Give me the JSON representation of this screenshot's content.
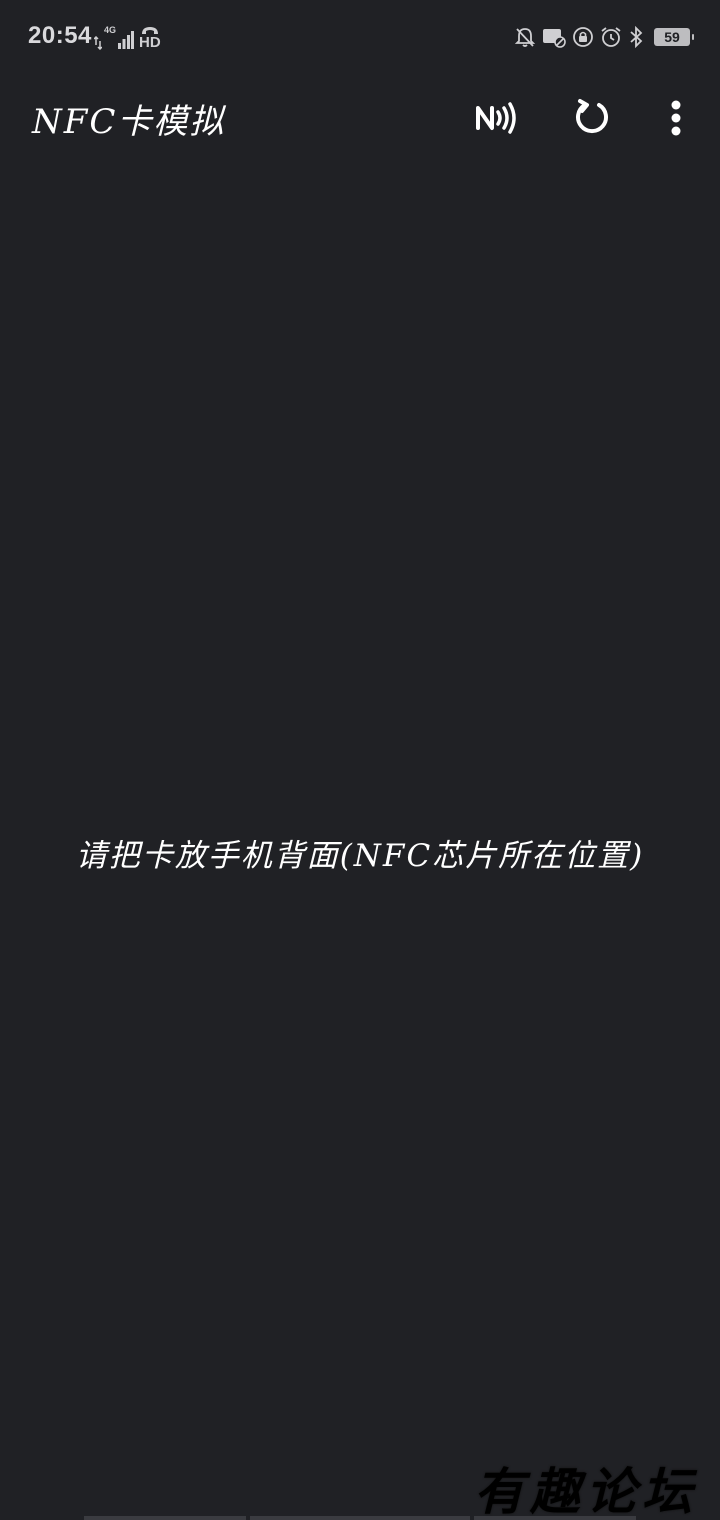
{
  "status_bar": {
    "time": "20:54",
    "network_label": "4G",
    "hd_label": "HD",
    "battery_level": "59"
  },
  "app_bar": {
    "title": "NFC卡模拟"
  },
  "main": {
    "hint": "请把卡放手机背面(NFC芯片所在位置)"
  },
  "watermark": {
    "text": "有趣论坛"
  },
  "colors": {
    "background": "#202125",
    "foreground": "#ffffff",
    "status_icons": "#d9d9dc"
  }
}
